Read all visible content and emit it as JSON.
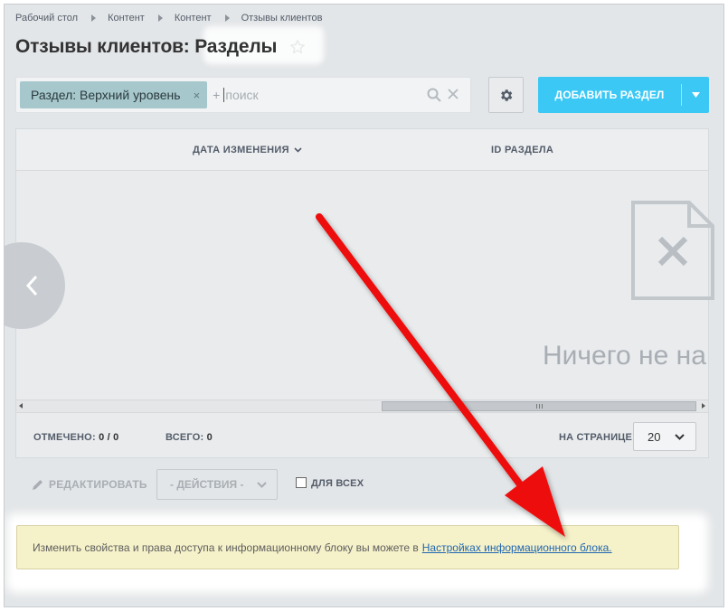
{
  "breadcrumb": [
    "Рабочий стол",
    "Контент",
    "Контент",
    "Отзывы клиентов"
  ],
  "title": {
    "part1": "Отзывы клиентов: ",
    "part2": "Разделы"
  },
  "filter": {
    "chip_label": "Раздел: Верхний уровень",
    "chip_close": "×",
    "plus": "+",
    "placeholder": "поиск"
  },
  "buttons": {
    "add_section": "ДОБАВИТЬ РАЗДЕЛ"
  },
  "grid": {
    "columns": [
      "ДАТА ИЗМЕНЕНИЯ",
      "ID РАЗДЕЛА"
    ],
    "empty_text": "Ничего не на"
  },
  "footer": {
    "checked_label": "ОТМЕЧЕНО:",
    "checked_value": "0 / 0",
    "total_label": "ВСЕГО:",
    "total_value": "0",
    "per_page_label": "НА СТРАНИЦЕ:",
    "per_page_value": "20"
  },
  "actions": {
    "edit": "РЕДАКТИРОВАТЬ",
    "actions_select": "- ДЕЙСТВИЯ -",
    "for_all": "ДЛЯ ВСЕХ"
  },
  "notice": {
    "text": "Изменить свойства и права доступа к информационному блоку вы можете в",
    "link": "Настройках информационного блока."
  },
  "colors": {
    "accent": "#3bc8f5",
    "chip": "#a6c7cb",
    "notice_bg": "#f5f1c9",
    "arrow": "#ee1111"
  }
}
